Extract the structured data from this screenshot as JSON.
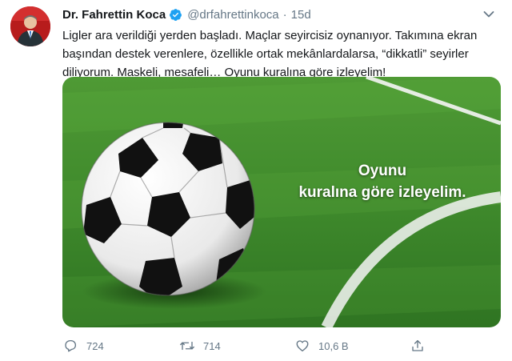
{
  "tweet": {
    "author_name": "Dr. Fahrettin Koca",
    "handle": "@drfahrettinkoca",
    "separator": "·",
    "time": "15d",
    "text": "Ligler ara verildiği yerden başladı. Maçlar seyircisiz oynanıyor. Takımına ekran başından destek verenlere, özellikle ortak mekânlardalarsa, “dikkatli” seyirler diliyorum. Maskeli, mesafeli… Oyunu kuralına göre izleyelim!",
    "media": {
      "overlay_line1": "Oyunu",
      "overlay_line2": "kuralına göre izleyelim."
    },
    "actions": {
      "reply_count": "724",
      "retweet_count": "714",
      "like_count": "10,6 B"
    }
  },
  "colors": {
    "accent": "#1da1f2",
    "muted": "#657786",
    "grass": "#3f8a2c"
  },
  "icons": [
    "verified-badge-icon",
    "chevron-down-icon",
    "reply-icon",
    "retweet-icon",
    "like-icon",
    "share-icon"
  ]
}
